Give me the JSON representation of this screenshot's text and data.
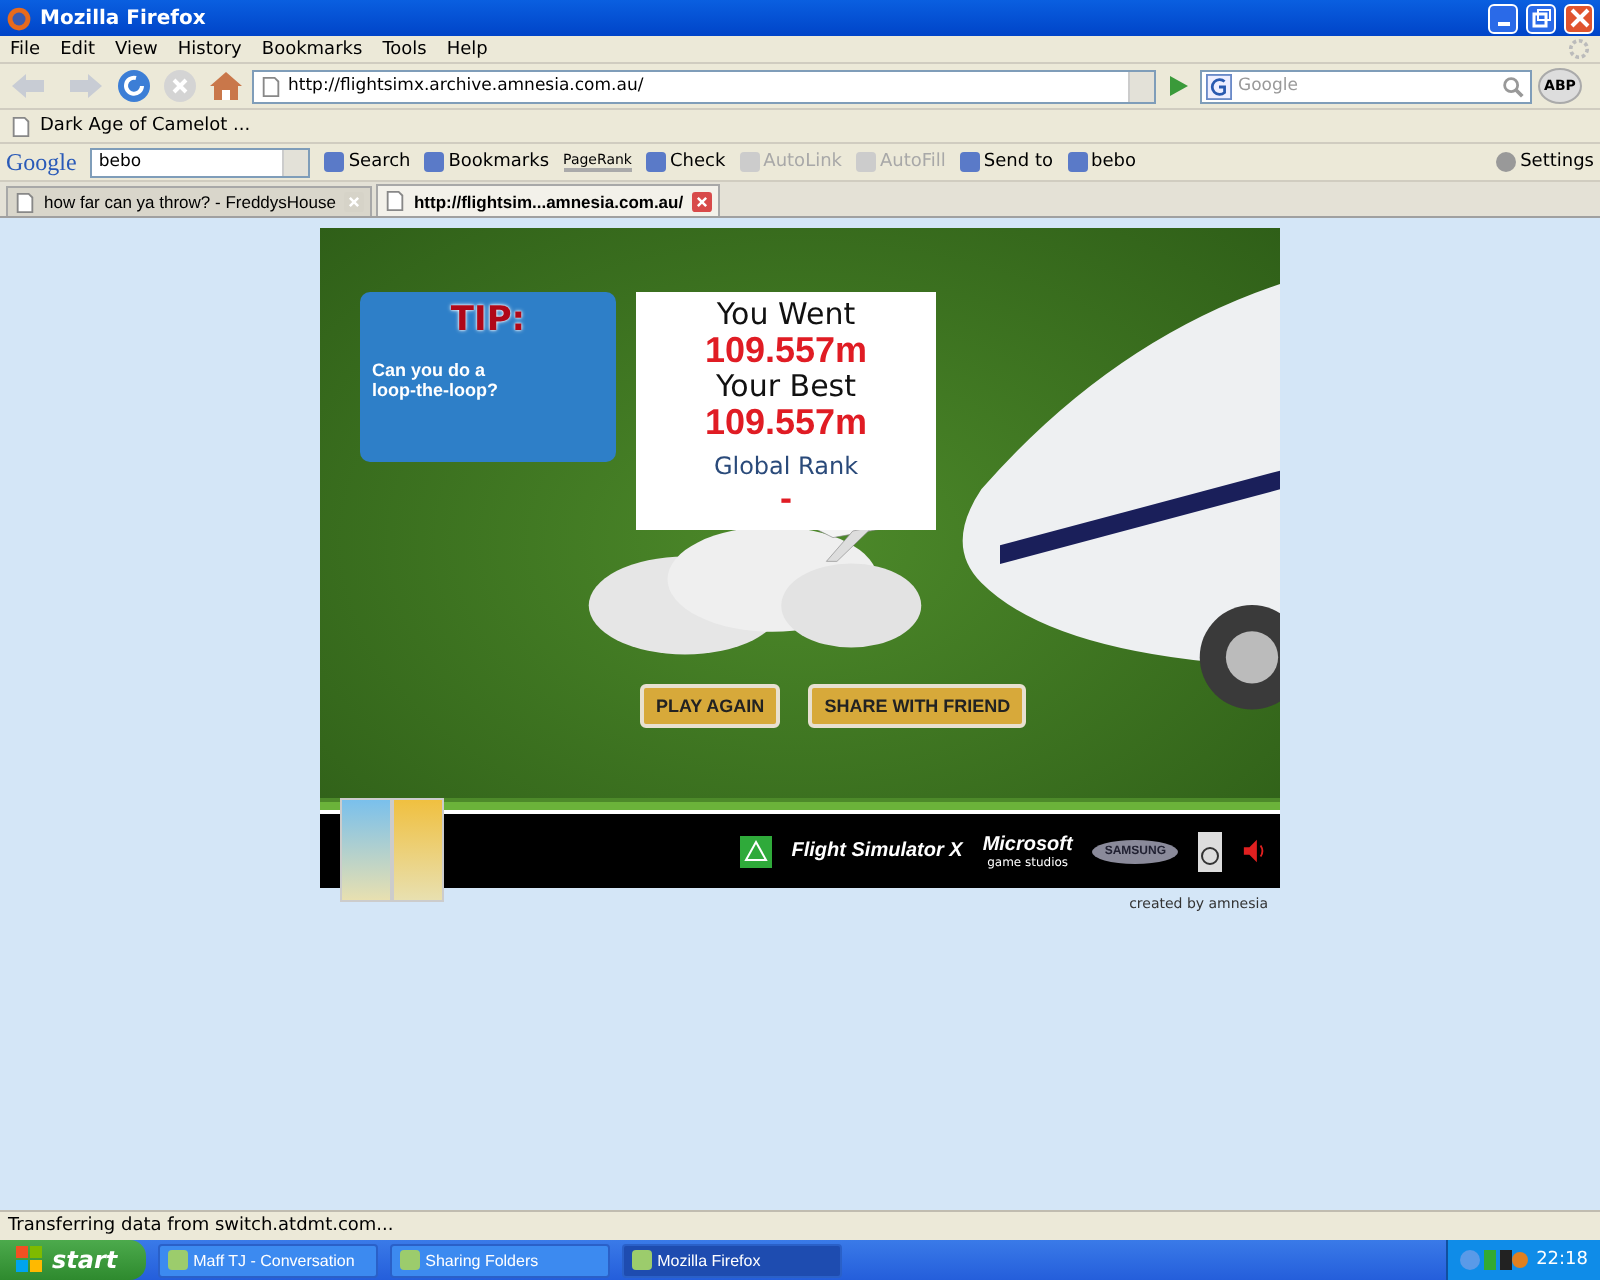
{
  "window": {
    "title": "Mozilla Firefox"
  },
  "menu": [
    "File",
    "Edit",
    "View",
    "History",
    "Bookmarks",
    "Tools",
    "Help"
  ],
  "address": {
    "value": "http://flightsimx.archive.amnesia.com.au/"
  },
  "search": {
    "placeholder": "Google"
  },
  "addon_button": "ABP",
  "bookmarks": [
    "Dark Age of Camelot ..."
  ],
  "google_toolbar": {
    "logo": "Google",
    "query": "bebo",
    "items": [
      {
        "kind": "button",
        "label": "Search",
        "disabled": false
      },
      {
        "kind": "button",
        "label": "Bookmarks",
        "disabled": false
      },
      {
        "kind": "pagerank",
        "label": "PageRank"
      },
      {
        "kind": "button",
        "label": "Check",
        "disabled": false
      },
      {
        "kind": "button",
        "label": "AutoLink",
        "disabled": true
      },
      {
        "kind": "button",
        "label": "AutoFill",
        "disabled": true
      },
      {
        "kind": "button",
        "label": "Send to",
        "disabled": false
      },
      {
        "kind": "button",
        "label": "bebo",
        "disabled": false
      }
    ],
    "settings": "Settings"
  },
  "tabs": [
    {
      "label": "how far can ya throw? - FreddysHouse",
      "selected": false
    },
    {
      "label": "http://flightsim...amnesia.com.au/",
      "selected": true
    }
  ],
  "game": {
    "tip": {
      "title": "TIP:",
      "text": "Can you do a loop-the-loop?"
    },
    "score": [
      {
        "kind": "label",
        "text": "You Went"
      },
      {
        "kind": "value",
        "text": "109.557m"
      },
      {
        "kind": "label",
        "text": "Your Best"
      },
      {
        "kind": "value",
        "text": "109.557m"
      },
      {
        "kind": "rank",
        "text": "Global Rank"
      },
      {
        "kind": "value",
        "text": "-"
      }
    ],
    "buttons": [
      "PLAY AGAIN",
      "SHARE WITH FRIEND"
    ],
    "sponsors": {
      "fsx": "Flight Simulator X",
      "ms_top": "Microsoft",
      "ms_bottom": "game studios",
      "samsung": "SAMSUNG"
    },
    "credit": "created by amnesia"
  },
  "status_bar": "Transferring data from switch.atdmt.com...",
  "taskbar": {
    "start": "start",
    "tasks": [
      {
        "label": "Maff TJ - Conversation",
        "selected": false
      },
      {
        "label": "Sharing Folders",
        "selected": false
      },
      {
        "label": "Mozilla Firefox",
        "selected": true
      }
    ],
    "clock": "22:18"
  }
}
